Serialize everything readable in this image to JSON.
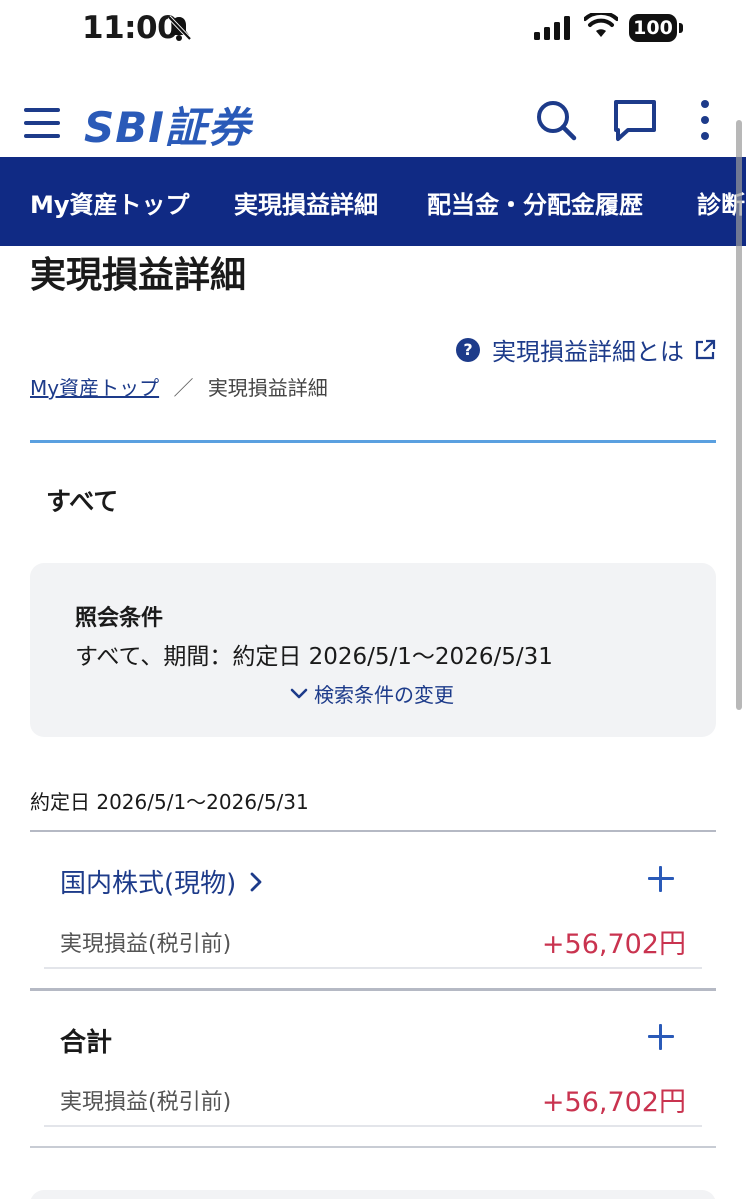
{
  "status": {
    "time": "11:00",
    "battery": "100"
  },
  "header": {
    "logo": "SBI証券"
  },
  "nav": {
    "items": [
      "My資産トップ",
      "実現損益詳細",
      "配当金・分配金履歴",
      "診断"
    ]
  },
  "page": {
    "title": "実現損益詳細",
    "help_link": "実現損益詳細とは",
    "breadcrumb": {
      "home": "My資産トップ",
      "separator": "／",
      "current": "実現損益詳細"
    },
    "tab": "すべて"
  },
  "conditions": {
    "title": "照会条件",
    "text": "すべて、期間：約定日 2026/5/1〜2026/5/31",
    "change_link": "検索条件の変更"
  },
  "date_range": "約定日 2026/5/1〜2026/5/31",
  "sections": [
    {
      "title": "国内株式(現物)",
      "has_chevron": true,
      "label": "実現損益(税引前)",
      "value": "+56,702円"
    },
    {
      "title": "合計",
      "has_chevron": false,
      "label": "実現損益(税引前)",
      "value": "+56,702円"
    }
  ],
  "colors": {
    "brand": "#2a5ab8",
    "nav_bg": "#102a84",
    "profit": "#c9334f",
    "link": "#1d3b8a"
  }
}
